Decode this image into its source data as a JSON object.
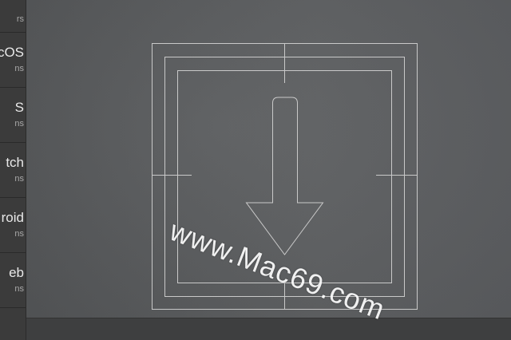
{
  "sidebar": {
    "top_sub": "rs",
    "items": [
      {
        "title": "cOS",
        "sub": "ns"
      },
      {
        "title": "S",
        "sub": "ns"
      },
      {
        "title": "tch",
        "sub": "ns"
      },
      {
        "title": "roid",
        "sub": "ns"
      },
      {
        "title": "eb",
        "sub": "ns"
      }
    ]
  },
  "canvas": {
    "icon": "download-arrow-icon-template"
  },
  "watermark": {
    "text": "www.Mac69.com"
  },
  "colors": {
    "sidebar_bg": "#3b3b3b",
    "canvas_bg": "#5a5c5e",
    "guide_line": "#c8c8c8"
  }
}
